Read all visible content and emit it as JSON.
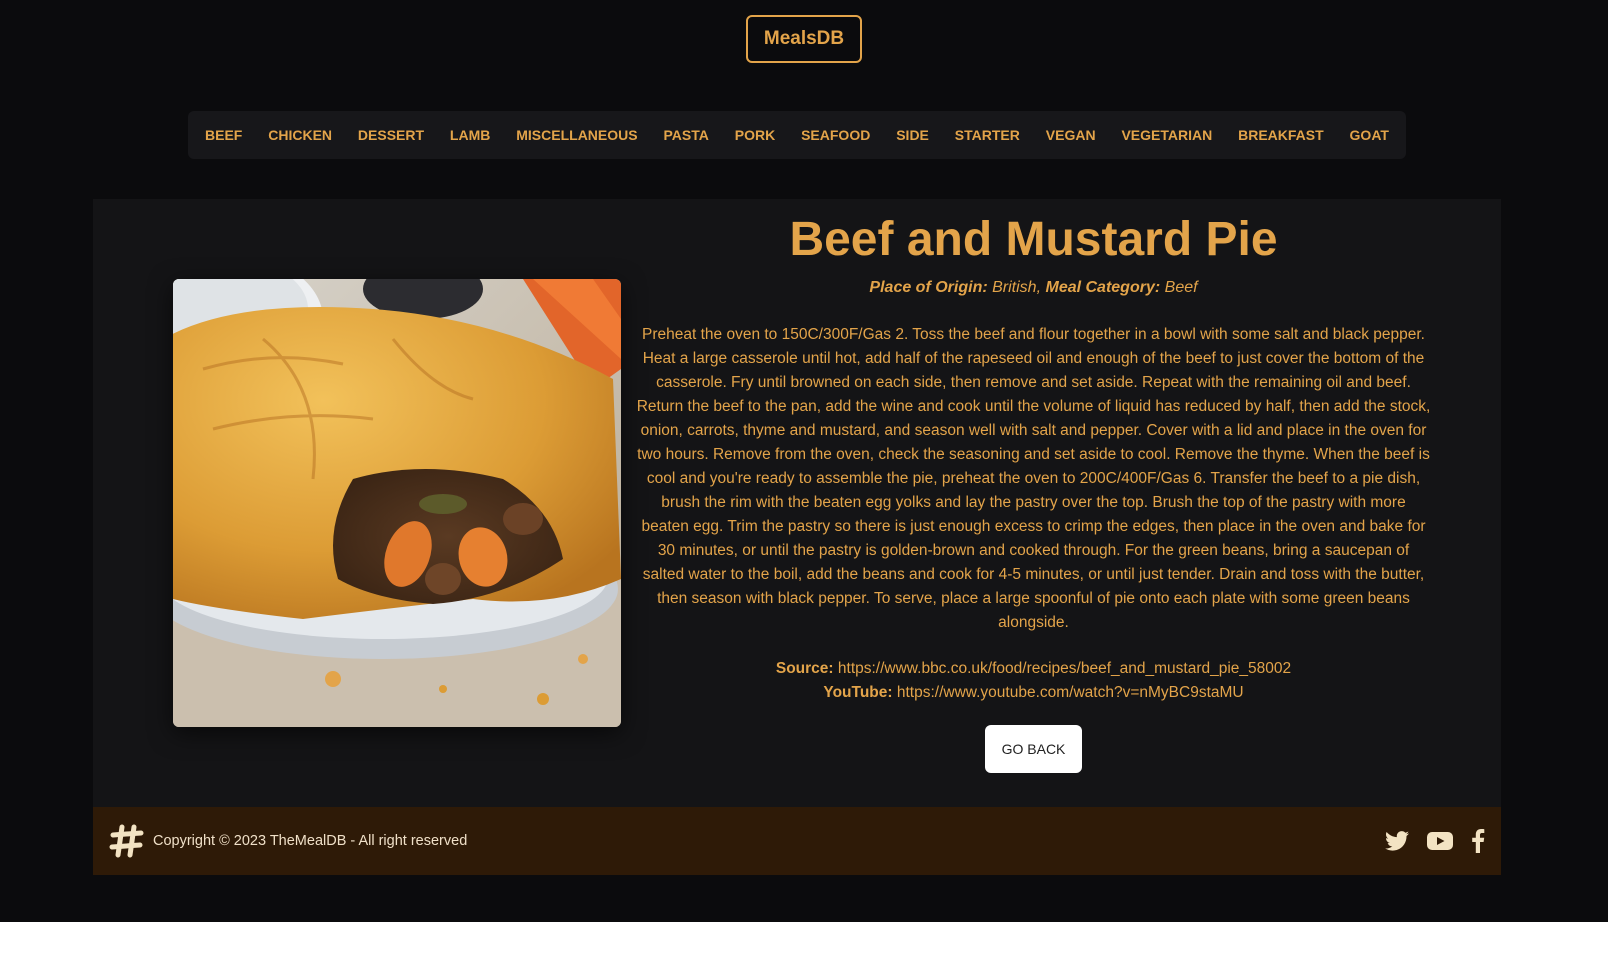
{
  "brand": "MealsDB",
  "nav": [
    "Beef",
    "Chicken",
    "Dessert",
    "Lamb",
    "Miscellaneous",
    "Pasta",
    "Pork",
    "Seafood",
    "Side",
    "Starter",
    "Vegan",
    "Vegetarian",
    "Breakfast",
    "Goat"
  ],
  "meal": {
    "title": "Beef and Mustard Pie",
    "origin_label": "Place of Origin:",
    "origin": "British,",
    "category_label": "Meal Category:",
    "category": "Beef",
    "instructions": "Preheat the oven to 150C/300F/Gas 2. Toss the beef and flour together in a bowl with some salt and black pepper. Heat a large casserole until hot, add half of the rapeseed oil and enough of the beef to just cover the bottom of the casserole. Fry until browned on each side, then remove and set aside. Repeat with the remaining oil and beef. Return the beef to the pan, add the wine and cook until the volume of liquid has reduced by half, then add the stock, onion, carrots, thyme and mustard, and season well with salt and pepper. Cover with a lid and place in the oven for two hours. Remove from the oven, check the seasoning and set aside to cool. Remove the thyme. When the beef is cool and you're ready to assemble the pie, preheat the oven to 200C/400F/Gas 6. Transfer the beef to a pie dish, brush the rim with the beaten egg yolks and lay the pastry over the top. Brush the top of the pastry with more beaten egg. Trim the pastry so there is just enough excess to crimp the edges, then place in the oven and bake for 30 minutes, or until the pastry is golden-brown and cooked through. For the green beans, bring a saucepan of salted water to the boil, add the beans and cook for 4-5 minutes, or until just tender. Drain and toss with the butter, then season with black pepper. To serve, place a large spoonful of pie onto each plate with some green beans alongside.",
    "source_label": "Source:",
    "source_url": "https://www.bbc.co.uk/food/recipes/beef_and_mustard_pie_58002",
    "youtube_label": "YouTube:",
    "youtube_url": "https://www.youtube.com/watch?v=nMyBC9staMU",
    "back_label": "GO BACK"
  },
  "footer": {
    "copyright": "Copyright © 2023 TheMealDB - All right reserved",
    "social_icons": [
      "twitter-icon",
      "youtube-icon",
      "facebook-icon"
    ]
  },
  "colors": {
    "accent": "#e3a44a",
    "background": "#0b0b0d",
    "panel": "#141416",
    "footer": "#2e1a07"
  }
}
